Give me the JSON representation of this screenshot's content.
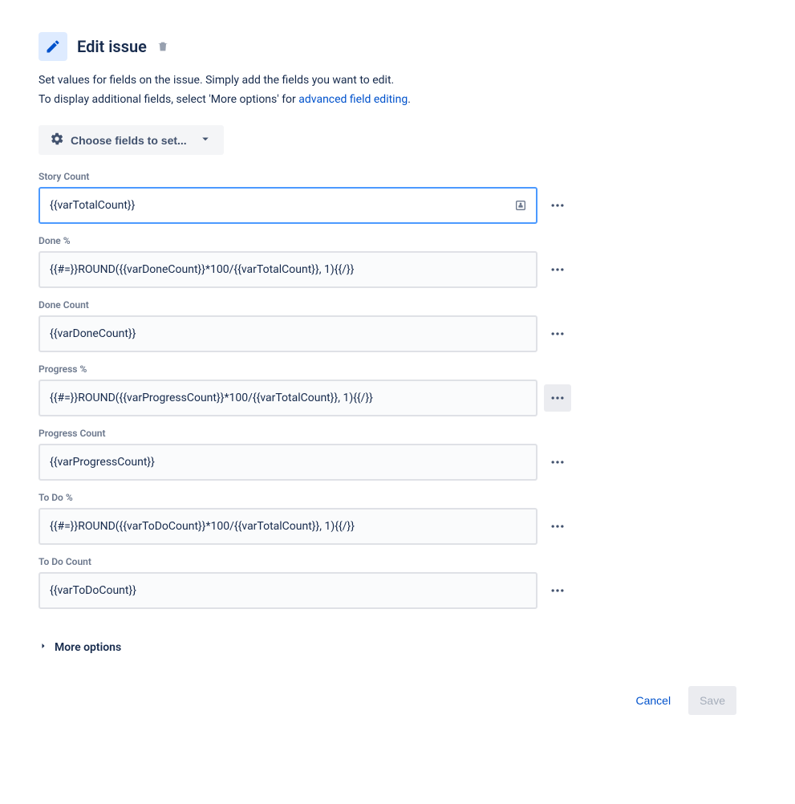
{
  "header": {
    "title": "Edit issue"
  },
  "description": {
    "line1": "Set values for fields on the issue. Simply add the fields you want to edit.",
    "line2_prefix": "To display additional fields, select 'More options' for ",
    "line2_link": "advanced field editing",
    "line2_suffix": "."
  },
  "choose_fields_label": "Choose fields to set...",
  "fields": [
    {
      "label": "Story Count",
      "value": "{{varTotalCount}}",
      "focused": true,
      "dots_hover": false,
      "badge": true
    },
    {
      "label": "Done %",
      "value": "{{#=}}ROUND({{varDoneCount}}*100/{{varTotalCount}}, 1){{/}}",
      "focused": false,
      "dots_hover": false,
      "badge": false
    },
    {
      "label": "Done Count",
      "value": "{{varDoneCount}}",
      "focused": false,
      "dots_hover": false,
      "badge": false
    },
    {
      "label": "Progress %",
      "value": "{{#=}}ROUND({{varProgressCount}}*100/{{varTotalCount}}, 1){{/}}",
      "focused": false,
      "dots_hover": true,
      "badge": false
    },
    {
      "label": "Progress Count",
      "value": "{{varProgressCount}}",
      "focused": false,
      "dots_hover": false,
      "badge": false
    },
    {
      "label": "To Do %",
      "value": "{{#=}}ROUND({{varToDoCount}}*100/{{varTotalCount}}, 1){{/}}",
      "focused": false,
      "dots_hover": false,
      "badge": false
    },
    {
      "label": "To Do Count",
      "value": "{{varToDoCount}}",
      "focused": false,
      "dots_hover": false,
      "badge": false
    }
  ],
  "more_options_label": "More options",
  "footer": {
    "cancel": "Cancel",
    "save": "Save"
  }
}
